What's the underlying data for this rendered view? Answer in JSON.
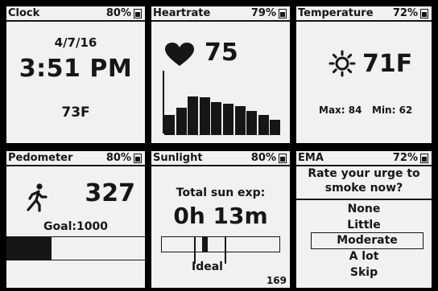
{
  "clock": {
    "title": "Clock",
    "battery_pct": "80%",
    "battery_level": 0.8,
    "date": "4/7/16",
    "time": "3:51 PM",
    "temp": "73F"
  },
  "heartrate": {
    "title": "Heartrate",
    "battery_pct": "79%",
    "battery_level": 0.79,
    "icon": "heart-icon",
    "value": "75",
    "bars": [
      0.32,
      0.44,
      0.62,
      0.6,
      0.52,
      0.5,
      0.46,
      0.38,
      0.32,
      0.24
    ]
  },
  "temperature": {
    "title": "Temperature",
    "battery_pct": "72%",
    "battery_level": 0.72,
    "icon": "sun-icon",
    "value": "71F",
    "max_label": "Max: 84",
    "min_label": "Min: 62"
  },
  "pedometer": {
    "title": "Pedometer",
    "battery_pct": "80%",
    "battery_level": 0.8,
    "icon": "walking-person-icon",
    "steps": "327",
    "goal": "Goal:1000",
    "progress": 0.327
  },
  "sunlight": {
    "title": "Sunlight",
    "battery_pct": "80%",
    "battery_level": 0.8,
    "label": "Total sun exp:",
    "value": "0h 13m",
    "ideal_label": "Ideal",
    "count": "169"
  },
  "ema": {
    "title": "EMA",
    "battery_pct": "72%",
    "battery_level": 0.72,
    "question_line1": "Rate your urge to",
    "question_line2": "smoke now?",
    "options": [
      "None",
      "Little",
      "Moderate",
      "A lot",
      "Skip"
    ],
    "selected": "Moderate"
  }
}
